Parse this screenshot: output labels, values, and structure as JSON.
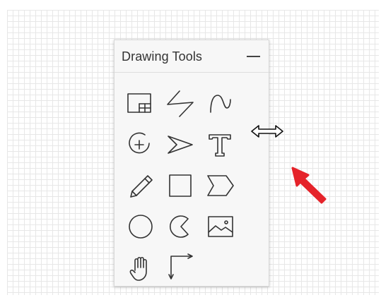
{
  "panel": {
    "title": "Drawing Tools",
    "collapse_icon": "minus-icon"
  },
  "tools": [
    {
      "name": "table-icon",
      "row": 1,
      "col": 1
    },
    {
      "name": "zigzag-line-icon",
      "row": 1,
      "col": 2
    },
    {
      "name": "curve-icon",
      "row": 1,
      "col": 3
    },
    {
      "name": "add-circle-icon",
      "row": 2,
      "col": 1
    },
    {
      "name": "arrow-pointer-icon",
      "row": 2,
      "col": 2
    },
    {
      "name": "text-icon",
      "row": 2,
      "col": 3
    },
    {
      "name": "pencil-icon",
      "row": 3,
      "col": 1
    },
    {
      "name": "rectangle-icon",
      "row": 3,
      "col": 2
    },
    {
      "name": "chevron-shape-icon",
      "row": 3,
      "col": 3
    },
    {
      "name": "circle-icon",
      "row": 4,
      "col": 1
    },
    {
      "name": "pie-shape-icon",
      "row": 4,
      "col": 2
    },
    {
      "name": "image-icon",
      "row": 4,
      "col": 3
    },
    {
      "name": "hand-icon",
      "row": 5,
      "col": 1
    },
    {
      "name": "connector-arrow-icon",
      "row": 5,
      "col": 2
    }
  ],
  "overlay": {
    "cursor": "horizontal-resize-cursor-icon",
    "annotation": "red-arrow-icon",
    "annotation_color": "#e5232a"
  }
}
